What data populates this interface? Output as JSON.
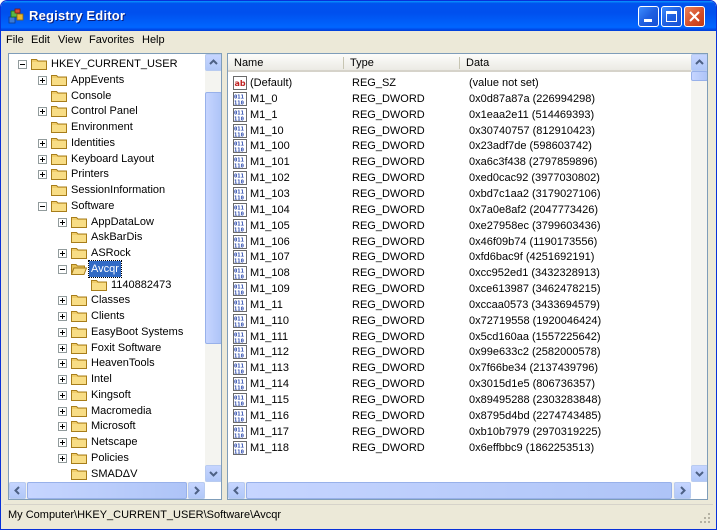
{
  "window": {
    "title": "Registry Editor",
    "accent": "#0054e3",
    "selection_color": "#316ac5"
  },
  "menu": [
    "File",
    "Edit",
    "View",
    "Favorites",
    "Help"
  ],
  "tree": {
    "items": [
      {
        "label": "HKEY_CURRENT_USER",
        "level": 0,
        "expander": "minus",
        "icon": "folder-icon"
      },
      {
        "label": "AppEvents",
        "level": 1,
        "expander": "plus",
        "icon": "folder-icon"
      },
      {
        "label": "Console",
        "level": 1,
        "expander": "none",
        "icon": "folder-icon"
      },
      {
        "label": "Control Panel",
        "level": 1,
        "expander": "plus",
        "icon": "folder-icon"
      },
      {
        "label": "Environment",
        "level": 1,
        "expander": "none",
        "icon": "folder-icon"
      },
      {
        "label": "Identities",
        "level": 1,
        "expander": "plus",
        "icon": "folder-icon"
      },
      {
        "label": "Keyboard Layout",
        "level": 1,
        "expander": "plus",
        "icon": "folder-icon"
      },
      {
        "label": "Printers",
        "level": 1,
        "expander": "plus",
        "icon": "folder-icon"
      },
      {
        "label": "SessionInformation",
        "level": 1,
        "expander": "none",
        "icon": "folder-icon"
      },
      {
        "label": "Software",
        "level": 1,
        "expander": "minus",
        "icon": "folder-icon"
      },
      {
        "label": "AppDataLow",
        "level": 2,
        "expander": "plus",
        "icon": "folder-icon"
      },
      {
        "label": "AskBarDis",
        "level": 2,
        "expander": "none",
        "icon": "folder-icon"
      },
      {
        "label": "ASRock",
        "level": 2,
        "expander": "plus",
        "icon": "folder-icon"
      },
      {
        "label": "Avcqr",
        "level": 2,
        "expander": "minus",
        "icon": "open-folder-icon",
        "selected": true
      },
      {
        "label": "1140882473",
        "level": 3,
        "expander": "none",
        "icon": "folder-icon"
      },
      {
        "label": "Classes",
        "level": 2,
        "expander": "plus",
        "icon": "folder-icon"
      },
      {
        "label": "Clients",
        "level": 2,
        "expander": "plus",
        "icon": "folder-icon"
      },
      {
        "label": "EasyBoot Systems",
        "level": 2,
        "expander": "plus",
        "icon": "folder-icon"
      },
      {
        "label": "Foxit Software",
        "level": 2,
        "expander": "plus",
        "icon": "folder-icon"
      },
      {
        "label": "HeavenTools",
        "level": 2,
        "expander": "plus",
        "icon": "folder-icon"
      },
      {
        "label": "Intel",
        "level": 2,
        "expander": "plus",
        "icon": "folder-icon"
      },
      {
        "label": "Kingsoft",
        "level": 2,
        "expander": "plus",
        "icon": "folder-icon"
      },
      {
        "label": "Macromedia",
        "level": 2,
        "expander": "plus",
        "icon": "folder-icon"
      },
      {
        "label": "Microsoft",
        "level": 2,
        "expander": "plus",
        "icon": "folder-icon"
      },
      {
        "label": "Netscape",
        "level": 2,
        "expander": "plus",
        "icon": "folder-icon"
      },
      {
        "label": "Policies",
        "level": 2,
        "expander": "plus",
        "icon": "folder-icon"
      },
      {
        "label": "SMADΔV",
        "level": 2,
        "expander": "none",
        "icon": "folder-icon"
      }
    ]
  },
  "list": {
    "columns": [
      "Name",
      "Type",
      "Data"
    ],
    "rows": [
      {
        "name": "(Default)",
        "type": "REG_SZ",
        "data": "(value not set)",
        "icon": "string-value-icon"
      },
      {
        "name": "M1_0",
        "type": "REG_DWORD",
        "data": "0x0d87a87a (226994298)",
        "icon": "binary-value-icon"
      },
      {
        "name": "M1_1",
        "type": "REG_DWORD",
        "data": "0x1eaa2e11 (514469393)",
        "icon": "binary-value-icon"
      },
      {
        "name": "M1_10",
        "type": "REG_DWORD",
        "data": "0x30740757 (812910423)",
        "icon": "binary-value-icon"
      },
      {
        "name": "M1_100",
        "type": "REG_DWORD",
        "data": "0x23adf7de (598603742)",
        "icon": "binary-value-icon"
      },
      {
        "name": "M1_101",
        "type": "REG_DWORD",
        "data": "0xa6c3f438 (2797859896)",
        "icon": "binary-value-icon"
      },
      {
        "name": "M1_102",
        "type": "REG_DWORD",
        "data": "0xed0cac92 (3977030802)",
        "icon": "binary-value-icon"
      },
      {
        "name": "M1_103",
        "type": "REG_DWORD",
        "data": "0xbd7c1aa2 (3179027106)",
        "icon": "binary-value-icon"
      },
      {
        "name": "M1_104",
        "type": "REG_DWORD",
        "data": "0x7a0e8af2 (2047773426)",
        "icon": "binary-value-icon"
      },
      {
        "name": "M1_105",
        "type": "REG_DWORD",
        "data": "0xe27958ec (3799603436)",
        "icon": "binary-value-icon"
      },
      {
        "name": "M1_106",
        "type": "REG_DWORD",
        "data": "0x46f09b74 (1190173556)",
        "icon": "binary-value-icon"
      },
      {
        "name": "M1_107",
        "type": "REG_DWORD",
        "data": "0xfd6bac9f (4251692191)",
        "icon": "binary-value-icon"
      },
      {
        "name": "M1_108",
        "type": "REG_DWORD",
        "data": "0xcc952ed1 (3432328913)",
        "icon": "binary-value-icon"
      },
      {
        "name": "M1_109",
        "type": "REG_DWORD",
        "data": "0xce613987 (3462478215)",
        "icon": "binary-value-icon"
      },
      {
        "name": "M1_11",
        "type": "REG_DWORD",
        "data": "0xccaa0573 (3433694579)",
        "icon": "binary-value-icon"
      },
      {
        "name": "M1_110",
        "type": "REG_DWORD",
        "data": "0x72719558 (1920046424)",
        "icon": "binary-value-icon"
      },
      {
        "name": "M1_111",
        "type": "REG_DWORD",
        "data": "0x5cd160aa (1557225642)",
        "icon": "binary-value-icon"
      },
      {
        "name": "M1_112",
        "type": "REG_DWORD",
        "data": "0x99e633c2 (2582000578)",
        "icon": "binary-value-icon"
      },
      {
        "name": "M1_113",
        "type": "REG_DWORD",
        "data": "0x7f66be34 (2137439796)",
        "icon": "binary-value-icon"
      },
      {
        "name": "M1_114",
        "type": "REG_DWORD",
        "data": "0x3015d1e5 (806736357)",
        "icon": "binary-value-icon"
      },
      {
        "name": "M1_115",
        "type": "REG_DWORD",
        "data": "0x89495288 (2303283848)",
        "icon": "binary-value-icon"
      },
      {
        "name": "M1_116",
        "type": "REG_DWORD",
        "data": "0x8795d4bd (2274743485)",
        "icon": "binary-value-icon"
      },
      {
        "name": "M1_117",
        "type": "REG_DWORD",
        "data": "0xb10b7979 (2970319225)",
        "icon": "binary-value-icon"
      },
      {
        "name": "M1_118",
        "type": "REG_DWORD",
        "data": "0x6effbbc9 (1862253513)",
        "icon": "binary-value-icon"
      }
    ]
  },
  "status": {
    "path": "My Computer\\HKEY_CURRENT_USER\\Software\\Avcqr"
  }
}
